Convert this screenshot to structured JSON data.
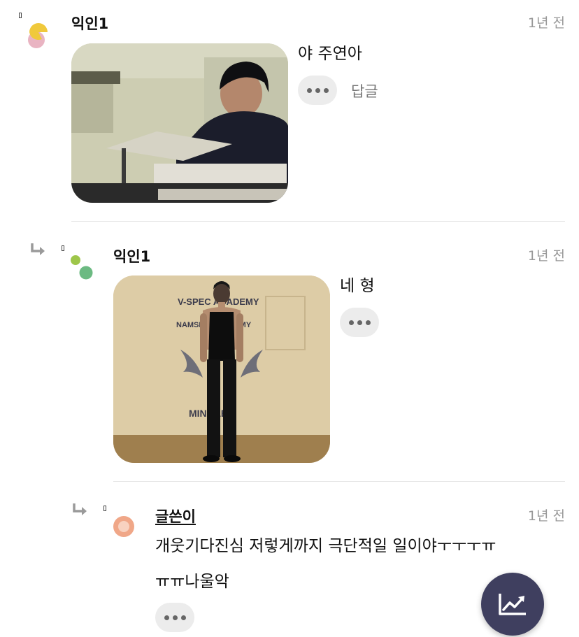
{
  "comments": [
    {
      "author": "익인1",
      "time": "1년 전",
      "text": "야 주연아",
      "reply_label": "답글"
    },
    {
      "author": "익인1",
      "time": "1년 전",
      "text": "네 형",
      "photo_signs": {
        "line1": "V-SPEC ACADEMY",
        "line2": "NAMSE... ACADEMY",
        "line3": "MIN...LE"
      }
    },
    {
      "author": "글쓴이",
      "time": "1년 전",
      "text_line1": "개웃기다진심 저렇게까지 극단적일 일이야ㅜㅜㅜㅠ",
      "text_line2": "ㅠㅠ나울악"
    }
  ],
  "icons": {
    "reply_arrow": "reply-arrow-icon",
    "more": "more-dots-icon",
    "fab": "trending-up-chart-icon"
  },
  "colors": {
    "fab_bg": "#3f3f5f",
    "avatar1_yellow": "#f0c93c",
    "avatar1_pink": "#e9b4c2",
    "avatar2_lime": "#9ec64a",
    "avatar2_green": "#6cba82",
    "avatar3_orange": "#f0a788"
  }
}
